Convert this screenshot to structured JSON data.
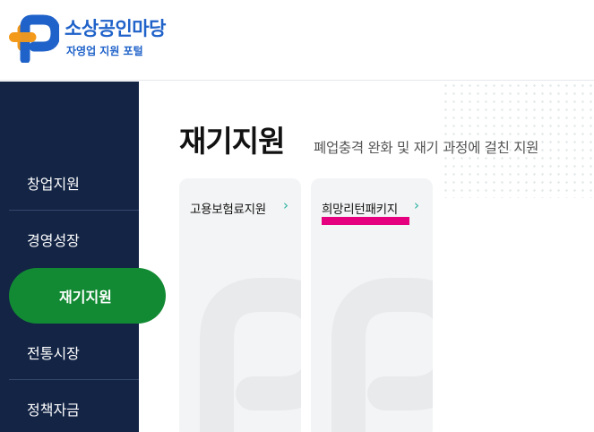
{
  "header": {
    "logo_title": "소상공인마당",
    "logo_subtitle": "자영업 지원 포털"
  },
  "sidebar": {
    "items": [
      {
        "label": "창업지원"
      },
      {
        "label": "경영성장"
      },
      {
        "label": "재기지원"
      },
      {
        "label": "전통시장"
      },
      {
        "label": "정책자금"
      }
    ]
  },
  "main": {
    "title": "재기지원",
    "description": "폐업충격 완화 및 재기 과정에 걸친 지원",
    "cards": [
      {
        "label": "고용보험료지원"
      },
      {
        "label": "희망리턴패키지"
      }
    ]
  },
  "colors": {
    "brand_blue": "#1f62c9",
    "brand_orange": "#f39a1b",
    "sidebar_bg": "#132445",
    "active_green": "#128a33",
    "highlight_magenta": "#e4007f",
    "chevron_teal": "#27b3a0"
  },
  "icons": [
    "logo-p-plus-icon",
    "chevron-right-icon"
  ]
}
